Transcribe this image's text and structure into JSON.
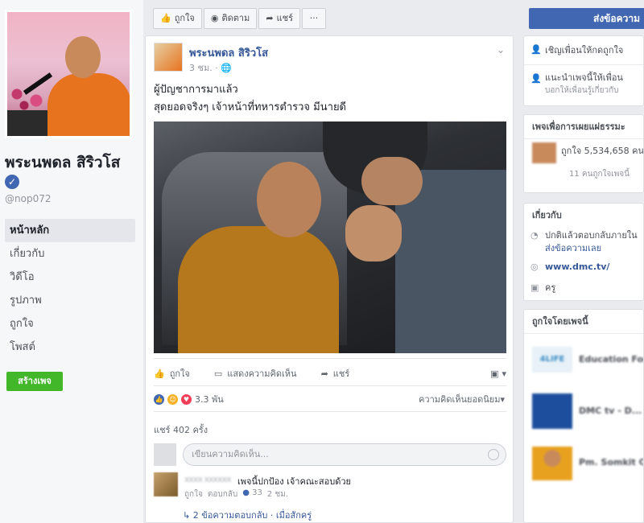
{
  "page": {
    "name": "พระนพดล สิริวโส",
    "verified_mark": "✓",
    "handle": "@nop072"
  },
  "nav": {
    "items": [
      {
        "label": "หน้าหลัก",
        "active": true
      },
      {
        "label": "เกี่ยวกับ",
        "active": false
      },
      {
        "label": "วิดีโอ",
        "active": false
      },
      {
        "label": "รูปภาพ",
        "active": false
      },
      {
        "label": "ถูกใจ",
        "active": false
      },
      {
        "label": "โพสต์",
        "active": false
      }
    ],
    "create_page_label": "สร้างเพจ"
  },
  "action_bar": {
    "like_label": "ถูกใจ",
    "follow_label": "ติดตาม",
    "share_label": "แชร์",
    "more_label": "···"
  },
  "post": {
    "author": "พระนพดล สิริวโส",
    "time": "3 ชม. ·",
    "line1": "ผู้ปัญชาการมาแล้ว",
    "line2": "สุดยอดจริงๆ เจ้าหน้าที่ทหารตำรวจ มีนายดี",
    "actions": {
      "like": "ถูกใจ",
      "comment": "แสดงความคิดเห็น",
      "share": "แชร์"
    },
    "reaction_count": "3.3 พัน",
    "comment_sort": "ความคิดเห็นยอดนิยม▾",
    "shares": "แชร์ 402 ครั้ง",
    "comment_placeholder": "เขียนความคิดเห็น..."
  },
  "comment": {
    "name": "xxxx xxxxxx",
    "text": "เพจนี้ปกป้อง เจ้าคณะสอบด้วย",
    "like_label": "ถูกใจ",
    "reply_label": "ตอบกลับ",
    "like_count": "33",
    "time": "2 ชม.",
    "replies": "2 ข้อความตอบกลับ · เมื่อสักครู่"
  },
  "right": {
    "send_message": "ส่งข้อความ",
    "invite": "เชิญเพื่อนให้กดถูกใจ",
    "recommend": "แนะนำเพจนี้ให้เพื่อน",
    "recommend_sub": "บอกให้เพื่อนรู้เกี่ยวกับ",
    "community_title": "เพจเพื่อการเผยแผ่ธรรมะ",
    "likes": "ถูกใจ 5,534,658 คน",
    "likes_sub": "11 คนถูกใจเพจนี้",
    "about_title": "เกี่ยวกับ",
    "about_msg": "ปกติแล้วตอบกลับภายใน",
    "about_msg2": "ส่งข้อความเลย",
    "website": "www.dmc.tv/",
    "category": "ครู",
    "liked_by_title": "ถูกใจโดยเพจนี้",
    "liked_pages": [
      "Education For",
      "DMC tv - D...",
      "Pm. Somkit C"
    ]
  }
}
